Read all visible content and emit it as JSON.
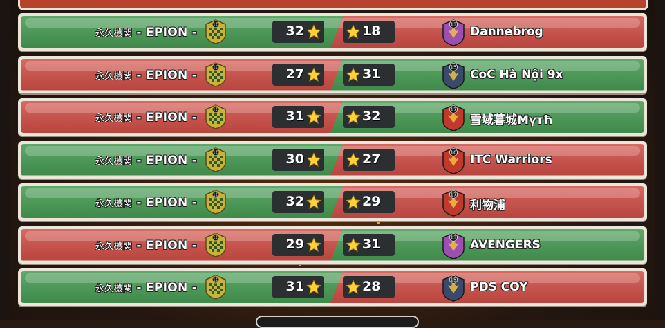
{
  "our_clan": {
    "name_cjk": "永久機関",
    "name": "- EPION -",
    "level": "10"
  },
  "colors": {
    "win": "#4f9a5a",
    "lose": "#c85650",
    "star": "#ffd23a"
  },
  "wars": [
    {
      "our_stars": "32",
      "opp_stars": "18",
      "opp_name": "Dannebrog",
      "opp_level": "13",
      "result": "win",
      "badge_color": "#9b4fb0"
    },
    {
      "our_stars": "27",
      "opp_stars": "31",
      "opp_name": "CoC Hà Nội 9x",
      "opp_level": "15",
      "result": "lose",
      "badge_color": "#3a4a6a"
    },
    {
      "our_stars": "31",
      "opp_stars": "32",
      "opp_name": "雪域暮城Mүтħ",
      "opp_level": "17",
      "result": "lose",
      "badge_color": "#c0392b"
    },
    {
      "our_stars": "30",
      "opp_stars": "27",
      "opp_name": "ITC Warriors",
      "opp_level": "16",
      "result": "win",
      "badge_color": "#c0392b"
    },
    {
      "our_stars": "32",
      "opp_stars": "29",
      "opp_name": "利物浦",
      "opp_level": "17",
      "result": "win",
      "badge_color": "#c0392b"
    },
    {
      "our_stars": "29",
      "opp_stars": "31",
      "opp_name": "AVENGERS",
      "opp_level": "13",
      "result": "lose",
      "badge_color": "#9b4fb0"
    },
    {
      "our_stars": "31",
      "opp_stars": "28",
      "opp_name": "PDS COY",
      "opp_level": "15",
      "result": "win",
      "badge_color": "#3a4a6a"
    }
  ]
}
